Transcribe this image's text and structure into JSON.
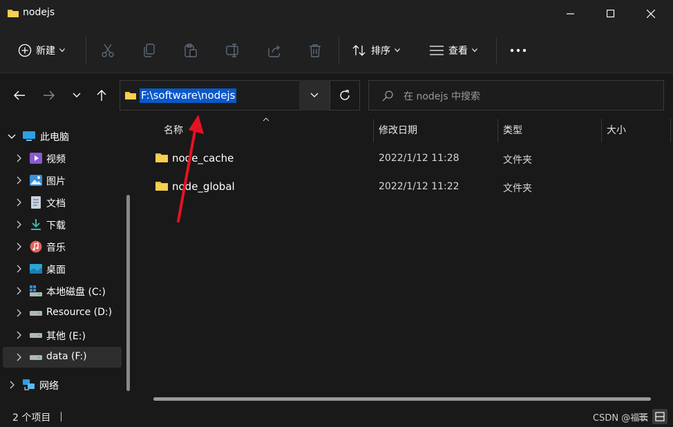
{
  "window": {
    "title": "nodejs",
    "minimize_icon": "minimize-icon",
    "maximize_icon": "maximize-icon",
    "close_icon": "close-icon"
  },
  "toolbar": {
    "new_label": "新建",
    "sort_label": "排序",
    "view_label": "查看",
    "more_icon": "more-icon"
  },
  "address": {
    "path": "F:\\software\\nodejs"
  },
  "search": {
    "placeholder": "在 nodejs 中搜索"
  },
  "sidebar": {
    "items": [
      {
        "label": "此电脑",
        "icon": "computer-icon"
      },
      {
        "label": "视频",
        "icon": "video-icon"
      },
      {
        "label": "图片",
        "icon": "pictures-icon"
      },
      {
        "label": "文档",
        "icon": "documents-icon"
      },
      {
        "label": "下载",
        "icon": "download-icon"
      },
      {
        "label": "音乐",
        "icon": "music-icon"
      },
      {
        "label": "桌面",
        "icon": "desktop-icon"
      },
      {
        "label": "本地磁盘 (C:)",
        "icon": "drive-icon"
      },
      {
        "label": "Resource (D:)",
        "icon": "drive-icon"
      },
      {
        "label": "其他 (E:)",
        "icon": "drive-icon"
      },
      {
        "label": "data (F:)",
        "icon": "drive-icon"
      },
      {
        "label": "网络",
        "icon": "network-icon"
      }
    ]
  },
  "columns": {
    "name": "名称",
    "modified": "修改日期",
    "type": "类型",
    "size": "大小"
  },
  "files": [
    {
      "name": "node_cache",
      "modified": "2022/1/12 11:28",
      "type": "文件夹"
    },
    {
      "name": "node_global",
      "modified": "2022/1/12 11:22",
      "type": "文件夹"
    }
  ],
  "status": {
    "item_count": "2 个项目",
    "watermark": "CSDN @福长"
  },
  "colors": {
    "accent": "#0a58ca",
    "folder": "#f3c13a",
    "annotation_arrow": "#e81123"
  }
}
